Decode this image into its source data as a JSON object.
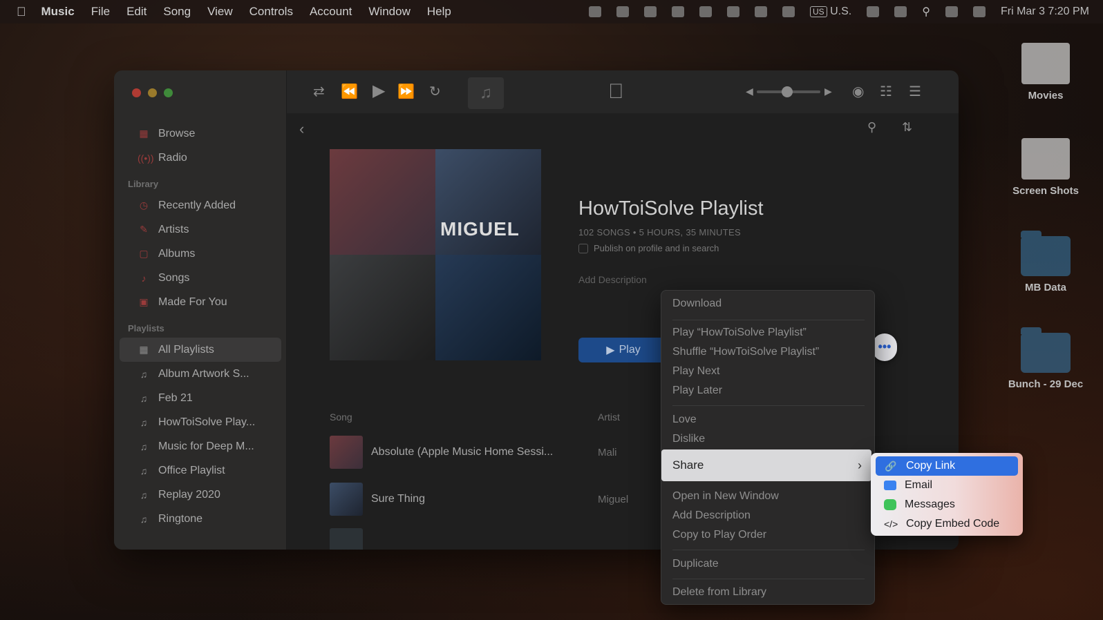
{
  "menubar": {
    "app": "Music",
    "items": [
      "File",
      "Edit",
      "Song",
      "View",
      "Controls",
      "Account",
      "Window",
      "Help"
    ],
    "input_source": "U.S.",
    "clock": "Fri Mar 3  7:20 PM"
  },
  "desktop": {
    "icons": [
      "Movies",
      "Screen Shots",
      "MB Data",
      "Bunch - 29 Dec"
    ]
  },
  "sidebar": {
    "top_items": [
      {
        "label": "Browse",
        "icon": "grid-icon"
      },
      {
        "label": "Radio",
        "icon": "radio-icon"
      }
    ],
    "library_heading": "Library",
    "library_items": [
      {
        "label": "Recently Added",
        "icon": "clock-icon"
      },
      {
        "label": "Artists",
        "icon": "microphone-icon"
      },
      {
        "label": "Albums",
        "icon": "album-icon"
      },
      {
        "label": "Songs",
        "icon": "note-icon"
      },
      {
        "label": "Made For You",
        "icon": "person-icon"
      }
    ],
    "playlists_heading": "Playlists",
    "playlist_items": [
      {
        "label": "All Playlists",
        "selected": true
      },
      {
        "label": "Album Artwork S..."
      },
      {
        "label": "Feb 21"
      },
      {
        "label": "HowToiSolve Play..."
      },
      {
        "label": "Music for Deep M..."
      },
      {
        "label": "Office Playlist"
      },
      {
        "label": "Replay 2020"
      },
      {
        "label": "Ringtone"
      }
    ]
  },
  "playlist": {
    "title": "HowToiSolve Playlist",
    "meta": "102 SONGS • 5 HOURS, 35 MINUTES",
    "publish_label": "Publish on profile and in search",
    "add_description": "Add Description",
    "play_label": "Play",
    "art_text": "MIGUEL",
    "columns": {
      "song": "Song",
      "artist": "Artist"
    },
    "songs": [
      {
        "title": "Absolute (Apple Music Home Sessi...",
        "artist": "Mali"
      },
      {
        "title": "Sure Thing",
        "artist": "Miguel"
      }
    ]
  },
  "context_menu": {
    "download": "Download",
    "play": "Play “HowToiSolve Playlist”",
    "shuffle": "Shuffle “HowToiSolve Playlist”",
    "play_next": "Play Next",
    "play_later": "Play Later",
    "love": "Love",
    "dislike": "Dislike",
    "share": "Share",
    "open_new_window": "Open in New Window",
    "add_description": "Add Description",
    "copy_play_order": "Copy to Play Order",
    "duplicate": "Duplicate",
    "delete": "Delete from Library"
  },
  "share_submenu": {
    "copy_link": "Copy Link",
    "email": "Email",
    "messages": "Messages",
    "copy_embed": "Copy Embed Code"
  },
  "colors": {
    "accent": "#2f6fe0",
    "play_button": "#1d4a8a"
  }
}
